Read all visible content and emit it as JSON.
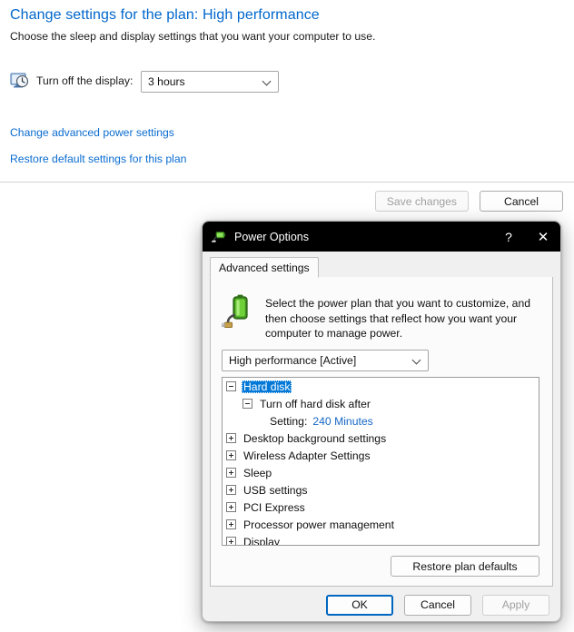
{
  "control_panel": {
    "title": "Change settings for the plan: High performance",
    "subtitle": "Choose the sleep and display settings that you want your computer to use.",
    "display_row": {
      "icon": "display-clock-icon",
      "label": "Turn off the display:",
      "value": "3 hours"
    },
    "links": [
      {
        "name": "change-advanced-power-settings",
        "text": "Change advanced power settings"
      },
      {
        "name": "restore-default-settings-for-this-plan",
        "text": "Restore default settings for this plan"
      }
    ],
    "buttons": {
      "save": "Save changes",
      "save_enabled": false,
      "cancel": "Cancel"
    }
  },
  "dialog": {
    "titlebar": {
      "icon": "power-plug-battery-icon",
      "title": "Power Options",
      "help": "?",
      "close": "✕"
    },
    "tab": "Advanced settings",
    "info": {
      "icon": "battery-plug-icon",
      "text": "Select the power plan that you want to customize, and then choose settings that reflect how you want your computer to manage power."
    },
    "plan_select": {
      "value": "High performance [Active]"
    },
    "tree": [
      {
        "label": "Hard disk",
        "level": 1,
        "state": "expanded",
        "selected": true
      },
      {
        "label": "Turn off hard disk after",
        "level": 2,
        "state": "expanded",
        "selected": false
      },
      {
        "label": "Setting:",
        "value": "240 Minutes",
        "level": 3,
        "state": "none",
        "selected": false
      },
      {
        "label": "Desktop background settings",
        "level": 1,
        "state": "collapsed",
        "selected": false
      },
      {
        "label": "Wireless Adapter Settings",
        "level": 1,
        "state": "collapsed",
        "selected": false
      },
      {
        "label": "Sleep",
        "level": 1,
        "state": "collapsed",
        "selected": false
      },
      {
        "label": "USB settings",
        "level": 1,
        "state": "collapsed",
        "selected": false
      },
      {
        "label": "PCI Express",
        "level": 1,
        "state": "collapsed",
        "selected": false
      },
      {
        "label": "Processor power management",
        "level": 1,
        "state": "collapsed",
        "selected": false
      },
      {
        "label": "Display",
        "level": 1,
        "state": "collapsed",
        "selected": false
      }
    ],
    "restore_plan_defaults": "Restore plan defaults",
    "footer": {
      "ok": "OK",
      "cancel": "Cancel",
      "apply": "Apply",
      "apply_enabled": false,
      "ok_focused": true
    }
  },
  "colors": {
    "heading_blue": "#0066cc",
    "link_blue": "#0a6cd0",
    "selection_blue": "#0078d7",
    "value_link_blue": "#1667c5",
    "titlebar_black": "#000000",
    "dialog_face": "#f0f0f0",
    "focus_blue": "#0067c0"
  }
}
